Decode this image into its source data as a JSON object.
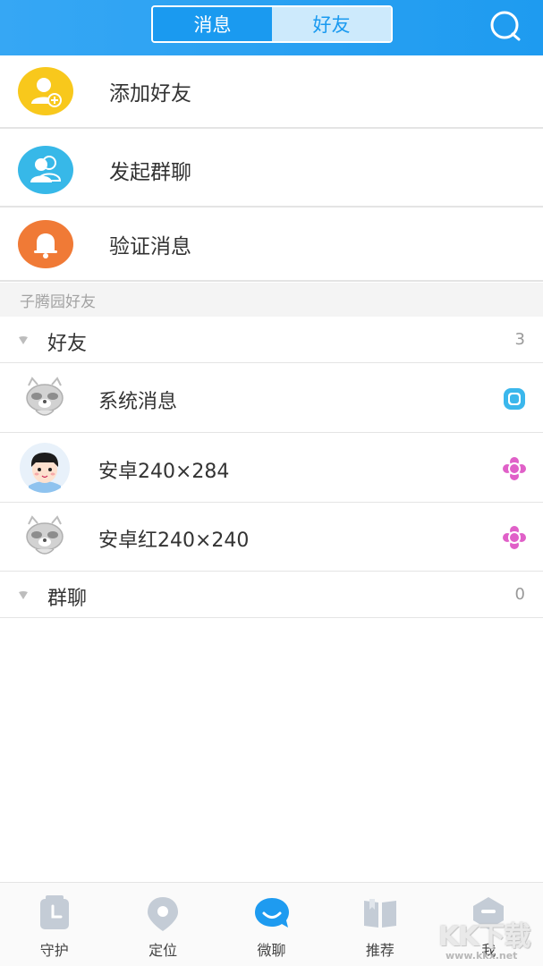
{
  "header": {
    "tabs": [
      {
        "label": "消息"
      },
      {
        "label": "好友"
      }
    ],
    "active_tab": "好友",
    "search_icon": "search-icon"
  },
  "actions": [
    {
      "label": "添加好友",
      "icon": "add-user-icon",
      "color": "#f8c81c"
    },
    {
      "label": "发起群聊",
      "icon": "group-icon",
      "color": "#37b8e8"
    },
    {
      "label": "验证消息",
      "icon": "bell-icon",
      "color": "#f07a36"
    }
  ],
  "section": {
    "title": "子腾园好友"
  },
  "groups": [
    {
      "name": "好友",
      "count": "3",
      "members": [
        {
          "name": "系统消息",
          "avatar": "raccoon-avatar",
          "device_icon": "watch-icon",
          "device_color": "#3bb7ec"
        },
        {
          "name": "安卓240×284",
          "avatar": "child-avatar",
          "device_icon": "flower-watch-icon",
          "device_color": "#e060c8"
        },
        {
          "name": "安卓红240×240",
          "avatar": "raccoon-avatar",
          "device_icon": "flower-watch-icon",
          "device_color": "#e060c8"
        }
      ]
    },
    {
      "name": "群聊",
      "count": "0",
      "members": []
    }
  ],
  "tabbar": {
    "items": [
      {
        "label": "守护",
        "icon": "clock-icon",
        "active": false
      },
      {
        "label": "定位",
        "icon": "location-pin-icon",
        "active": false
      },
      {
        "label": "微聊",
        "icon": "chat-bubble-icon",
        "active": true
      },
      {
        "label": "推荐",
        "icon": "book-icon",
        "active": false
      },
      {
        "label": "我",
        "icon": "profile-icon",
        "active": false
      }
    ],
    "active_color": "#1e9bf0",
    "inactive_color": "#c4ccd6"
  },
  "watermark": {
    "text": "KK下载",
    "url": "www.kkx.net"
  }
}
